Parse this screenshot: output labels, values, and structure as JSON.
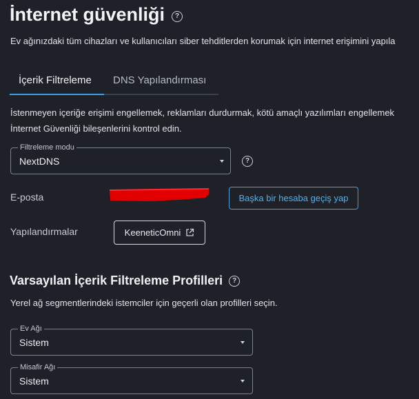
{
  "header": {
    "title": "İnternet güvenliği",
    "description": "Ev ağınızdaki tüm cihazları ve kullanıcıları siber tehditlerden korumak için internet erişimini yapıla"
  },
  "tabs": [
    {
      "label": "İçerik Filtreleme",
      "active": true
    },
    {
      "label": "DNS Yapılandırması",
      "active": false
    }
  ],
  "content_filter": {
    "intro_line1": "İstenmeyen içeriğe erişimi engellemek, reklamları durdurmak, kötü amaçlı yazılımları engellemek",
    "intro_line2": "İnternet Güvenliği bileşenlerini kontrol edin.",
    "mode_select": {
      "label": "Filtreleme modu",
      "value": "NextDNS"
    },
    "email": {
      "label": "E-posta",
      "switch_button": "Başka bir hesaba geçiş yap"
    },
    "configurations": {
      "label": "Yapılandırmalar",
      "button": "KeeneticOmni"
    }
  },
  "default_profiles": {
    "title": "Varsayılan İçerik Filtreleme Profilleri",
    "description": "Yerel ağ segmentlerindeki istemciler için geçerli olan profilleri seçin.",
    "home": {
      "label": "Ev Ağı",
      "value": "Sistem"
    },
    "guest": {
      "label": "Misafir Ağı",
      "value": "Sistem"
    }
  },
  "colors": {
    "background": "#1e2228",
    "accent": "#3fa1e6",
    "redaction": "#e00000"
  },
  "icons": {
    "help": "question-circle-icon",
    "dropdown": "caret-down-icon",
    "external": "external-link-icon"
  }
}
